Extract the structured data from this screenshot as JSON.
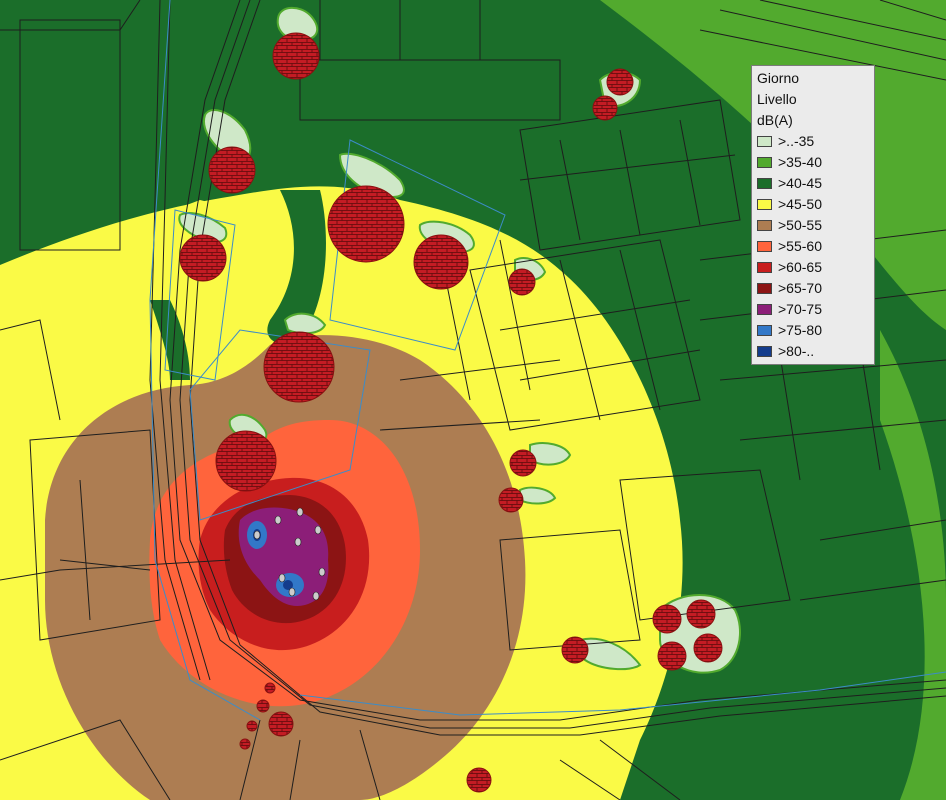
{
  "legend": {
    "title_lines": [
      "Giorno",
      "Livello",
      "dB(A)"
    ],
    "classes": [
      {
        "label": ">..-35",
        "color": "#cfe8c8"
      },
      {
        "label": ">35-40",
        "color": "#52aa2e"
      },
      {
        "label": ">40-45",
        "color": "#1b6e2a"
      },
      {
        "label": ">45-50",
        "color": "#fafa46"
      },
      {
        "label": ">50-55",
        "color": "#ad7d52"
      },
      {
        "label": ">55-60",
        "color": "#ff643c"
      },
      {
        "label": ">60-65",
        "color": "#c81e1e"
      },
      {
        "label": ">65-70",
        "color": "#8c1414"
      },
      {
        "label": ">70-75",
        "color": "#8c1e78"
      },
      {
        "label": ">75-80",
        "color": "#3278c8"
      },
      {
        "label": ">80-..",
        "color": "#143c8c"
      }
    ]
  },
  "map": {
    "background_color": "#2f7a34",
    "linework_color": "#1e1e1e",
    "building_outline_color": "#3c8cc8",
    "receptor_marker": "red-brick-circle"
  }
}
